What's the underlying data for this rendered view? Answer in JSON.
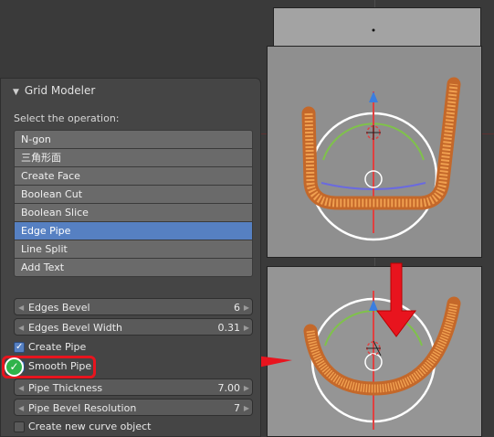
{
  "panel": {
    "title": "Grid Modeler",
    "operation_label": "Select the operation:",
    "operations": [
      "N-gon",
      "三角形面",
      "Create Face",
      "Boolean Cut",
      "Boolean Slice",
      "Edge Pipe",
      "Line Split",
      "Add Text"
    ],
    "selected_operation": "Edge Pipe",
    "fields": {
      "edges_bevel": {
        "label": "Edges Bevel",
        "value": "6"
      },
      "edges_bevel_width": {
        "label": "Edges Bevel Width",
        "value": "0.31"
      },
      "pipe_thickness": {
        "label": "Pipe Thickness",
        "value": "7.00"
      },
      "pipe_bevel_resolution": {
        "label": "Pipe Bevel Resolution",
        "value": "7"
      }
    },
    "checkboxes": {
      "create_pipe": {
        "label": "Create Pipe",
        "checked": true
      },
      "smooth_pipe": {
        "label": "Smooth Pipe",
        "checked": true
      },
      "create_new_curve": {
        "label": "Create new curve object",
        "checked": false
      }
    }
  },
  "colors": {
    "accent": "#5680c2",
    "annotation_red": "#e8141e",
    "pipe_orange": "#e8872a",
    "check_green": "#2fb34a"
  }
}
